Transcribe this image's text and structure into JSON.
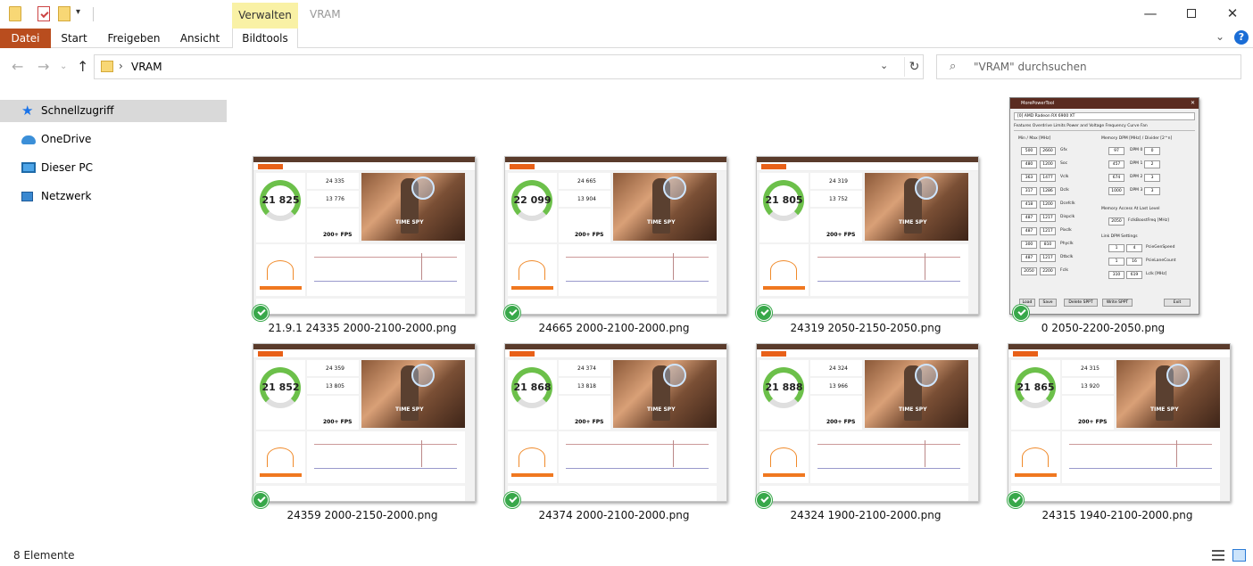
{
  "window": {
    "title": "VRAM",
    "context_tab": "Verwalten",
    "controls": {
      "minimize": "—",
      "close": "✕"
    }
  },
  "quick_access": {
    "customize_glyph": "▾"
  },
  "ribbon": {
    "tabs": [
      "Datei",
      "Start",
      "Freigeben",
      "Ansicht",
      "Bildtools"
    ],
    "collapse_glyph": "⌄",
    "help_glyph": "?"
  },
  "nav": {
    "back": "←",
    "forward": "→",
    "recent": "⌄",
    "up": "↑"
  },
  "address": {
    "separator": "›",
    "path": "VRAM",
    "dropdown": "⌄",
    "refresh": "↻"
  },
  "search": {
    "placeholder": "\"VRAM\" durchsuchen",
    "icon": "⌕"
  },
  "sidebar": {
    "items": [
      {
        "label": "Schnellzugriff",
        "icon": "star-icon",
        "glyph": "★"
      },
      {
        "label": "OneDrive",
        "icon": "cloud-icon"
      },
      {
        "label": "Dieser PC",
        "icon": "computer-icon"
      },
      {
        "label": "Netzwerk",
        "icon": "network-icon"
      }
    ]
  },
  "files": [
    {
      "name": "21.9.1 24335 2000-2100-2000.png",
      "score": "21 825",
      "gfx": "24 335",
      "cpu": "13 776",
      "fps": "200+ FPS",
      "label": "TIME SPY"
    },
    {
      "name": "24665 2000-2100-2000.png",
      "score": "22 099",
      "gfx": "24 665",
      "cpu": "13 904",
      "fps": "200+ FPS",
      "label": "TIME SPY"
    },
    {
      "name": "24319 2050-2150-2050.png",
      "score": "21 805",
      "gfx": "24 319",
      "cpu": "13 752",
      "fps": "200+ FPS",
      "label": "TIME SPY"
    },
    {
      "name": "0 2050-2200-2050.png",
      "type": "mpt"
    },
    {
      "name": "24359 2000-2150-2000.png",
      "score": "21 852",
      "gfx": "24 359",
      "cpu": "13 805",
      "fps": "200+ FPS",
      "label": "TIME SPY"
    },
    {
      "name": "24374 2000-2100-2000.png",
      "score": "21 868",
      "gfx": "24 374",
      "cpu": "13 818",
      "fps": "200+ FPS",
      "label": "TIME SPY"
    },
    {
      "name": "24324 1900-2100-2000.png",
      "score": "21 888",
      "gfx": "24 324",
      "cpu": "13 966",
      "fps": "200+ FPS",
      "label": "TIME SPY"
    },
    {
      "name": "24315 1940-2100-2000.png",
      "score": "21 865",
      "gfx": "24 315",
      "cpu": "13 920",
      "fps": "200+ FPS",
      "label": "TIME SPY"
    }
  ],
  "mpt_thumb": {
    "title": "MorePowerTool",
    "device": "[0] AMD Radeon RX 6900 XT",
    "tabs": "Features  Overdrive Limits  Power and Voltage  Frequency  Curve  Fan",
    "minmax_header": "Min / Max [MHz]",
    "dpm_header": "Memory DPM [MHz] / Divider [2^n]",
    "rows": [
      {
        "min": "500",
        "max": "2660",
        "name": "Gfx"
      },
      {
        "min": "480",
        "max": "1200",
        "name": "Soc"
      },
      {
        "min": "363",
        "max": "1477",
        "name": "Vclk"
      },
      {
        "min": "317",
        "max": "1286",
        "name": "Dclk"
      },
      {
        "min": "418",
        "max": "1200",
        "name": "Dcefclk"
      },
      {
        "min": "487",
        "max": "1217",
        "name": "Dispclk"
      },
      {
        "min": "487",
        "max": "1217",
        "name": "Pixclk"
      },
      {
        "min": "300",
        "max": "810",
        "name": "Phyclk"
      },
      {
        "min": "487",
        "max": "1217",
        "name": "Dtbclk"
      },
      {
        "min": "2050",
        "max": "2200",
        "name": "Fclk"
      }
    ],
    "dpm": [
      {
        "mhz": "97",
        "label": "DPM 0",
        "div": "0"
      },
      {
        "mhz": "457",
        "label": "DPM 1",
        "div": "2"
      },
      {
        "mhz": "674",
        "label": "DPM 2",
        "div": "3"
      },
      {
        "mhz": "1000",
        "label": "DPM 3",
        "div": "3"
      }
    ],
    "access_header": "Memory Access At Last Level",
    "boost_value": "2050",
    "boost_label": "FclkBoostFreq [MHz]",
    "link_header": "Link DPM Settings",
    "link": [
      {
        "a": "1",
        "b": "4",
        "label": "PcieGenSpeed"
      },
      {
        "a": "1",
        "b": "16",
        "label": "PcieLaneCount"
      },
      {
        "a": "310",
        "b": "619",
        "label": "Lclk [MHz]"
      }
    ],
    "buttons": [
      "Load",
      "Save",
      "Delete SPPT",
      "Write SPPT",
      "Exit"
    ]
  },
  "status": {
    "count": "8 Elemente"
  },
  "colors": {
    "datei": "#b94d1e",
    "accent": "#1a6dd6",
    "check": "#38a84a"
  }
}
